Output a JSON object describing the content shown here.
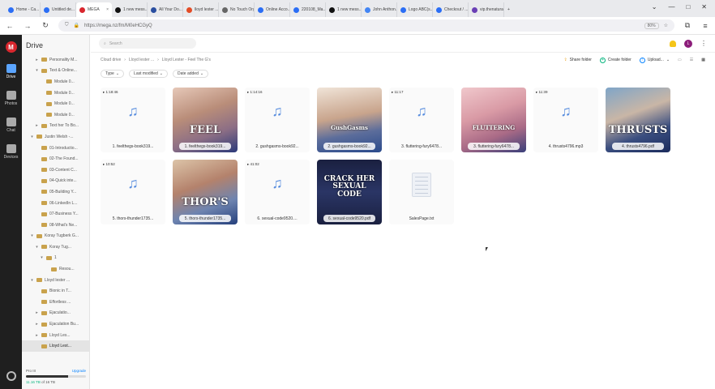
{
  "browser": {
    "tabs": [
      {
        "title": "Home - Ca...",
        "color": "#2b6ef5"
      },
      {
        "title": "Untitled de...",
        "color": "#2b6ef5"
      },
      {
        "title": "MEGA",
        "color": "#d9272e",
        "active": true
      },
      {
        "title": "1 new mess...",
        "color": "#111111"
      },
      {
        "title": "All Your Do...",
        "color": "#2b4fa0"
      },
      {
        "title": "lloyd lester ...",
        "color": "#e34c26"
      },
      {
        "title": "No Touch Orga...",
        "color": "#666666"
      },
      {
        "title": "Online Acco...",
        "color": "#2b6ef5"
      },
      {
        "title": "220108_Ma...",
        "color": "#2b6ef5"
      },
      {
        "title": "1 new mess...",
        "color": "#111111"
      },
      {
        "title": "John Anthon...",
        "color": "#4285f4"
      },
      {
        "title": "Logo ABC(s...",
        "color": "#2b6ef5"
      },
      {
        "title": "Checkout / ...",
        "color": "#2b6ef5"
      },
      {
        "title": "vip.thenatural...",
        "color": "#6a3fb5"
      }
    ],
    "url": "https://mega.nz/fm/M0eHCGyQ",
    "zoom": "80%",
    "window_controls": [
      "⌄",
      "—",
      "□",
      "✕"
    ]
  },
  "rail": {
    "items": [
      {
        "label": "Drive",
        "active": true
      },
      {
        "label": "Photos"
      },
      {
        "label": "Chat"
      },
      {
        "label": "Devices"
      }
    ]
  },
  "sidebar": {
    "title": "Drive",
    "tree": [
      {
        "label": "Personality M...",
        "indent": 2,
        "arrow": "▸"
      },
      {
        "label": "Text & Online...",
        "indent": 2,
        "arrow": "▾"
      },
      {
        "label": "Module 0...",
        "indent": 3,
        "arrow": ""
      },
      {
        "label": "Module 0...",
        "indent": 3,
        "arrow": ""
      },
      {
        "label": "Module 0...",
        "indent": 3,
        "arrow": ""
      },
      {
        "label": "Module 0...",
        "indent": 3,
        "arrow": ""
      },
      {
        "label": "Text her To Bo...",
        "indent": 2,
        "arrow": "▸"
      },
      {
        "label": "Justin Welsh -...",
        "indent": 1,
        "arrow": "▾"
      },
      {
        "label": "01-Introductio...",
        "indent": 2,
        "arrow": ""
      },
      {
        "label": "02-The Found...",
        "indent": 2,
        "arrow": ""
      },
      {
        "label": "03-Content C...",
        "indent": 2,
        "arrow": ""
      },
      {
        "label": "04-Quick inte...",
        "indent": 2,
        "arrow": ""
      },
      {
        "label": "05-Building Y...",
        "indent": 2,
        "arrow": ""
      },
      {
        "label": "06-LinkedIn L...",
        "indent": 2,
        "arrow": ""
      },
      {
        "label": "07-Business Y...",
        "indent": 2,
        "arrow": ""
      },
      {
        "label": "08-What's Ne...",
        "indent": 2,
        "arrow": ""
      },
      {
        "label": "Koray Tugberk G...",
        "indent": 1,
        "arrow": "▾"
      },
      {
        "label": "Koray Tug...",
        "indent": 2,
        "arrow": "▾"
      },
      {
        "label": "1",
        "indent": 3,
        "arrow": "▾"
      },
      {
        "label": "Resou...",
        "indent": 4,
        "arrow": ""
      },
      {
        "label": "Lloyd lester ...",
        "indent": 1,
        "arrow": "▾"
      },
      {
        "label": "Bionic in T...",
        "indent": 2,
        "arrow": ""
      },
      {
        "label": "Effortless ...",
        "indent": 2,
        "arrow": ""
      },
      {
        "label": "Ejaculatio...",
        "indent": 2,
        "arrow": "▸"
      },
      {
        "label": "Ejaculation Bu...",
        "indent": 2,
        "arrow": "▸"
      },
      {
        "label": "Lloyd Les...",
        "indent": 2,
        "arrow": "▸"
      },
      {
        "label": "Lloyd Lest...",
        "indent": 2,
        "arrow": "",
        "selected": true
      }
    ],
    "quota": {
      "plan": "Pro III",
      "upgrade": "Upgrade",
      "usage_prefix": "",
      "usage_used": "11.16 TB",
      "usage_rest": "of 16 TB",
      "fill": 0.7
    }
  },
  "main": {
    "search_placeholder": "Search",
    "avatar": "L",
    "breadcrumb": [
      "Cloud drive",
      "Lloyd lester ...",
      "Lloyd Lester - Feel The G's"
    ],
    "actions": {
      "share": "Share folder",
      "create": "Create folder",
      "upload": "Upload..."
    },
    "filters": [
      "Type",
      "Last modified",
      "Date added"
    ],
    "files": [
      {
        "type": "audio",
        "duration": "1:18:46",
        "name": "1. feelthegs-book319..."
      },
      {
        "type": "image",
        "thumb": "t1",
        "overlay": "FEEL",
        "name": "1. feelthegs-book319..."
      },
      {
        "type": "audio",
        "duration": "1:14:16",
        "name": "2. gushgasms-book92..."
      },
      {
        "type": "image",
        "thumb": "t2",
        "overlay": "GushGasms",
        "name": "2. gushgasms-book92..."
      },
      {
        "type": "audio",
        "duration": "11:17",
        "name": "3. fluttering-fury6478..."
      },
      {
        "type": "image",
        "thumb": "t3",
        "overlay": "FLUTTERING",
        "name": "3. fluttering-fury6478..."
      },
      {
        "type": "audio",
        "duration": "11:39",
        "name": "4. thrusts4796.mp3"
      },
      {
        "type": "image",
        "thumb": "t4",
        "overlay": "THRUSTS",
        "name": "4. thrusts4796.pdf"
      },
      {
        "type": "audio",
        "duration": "10:52",
        "name": "5. thors-thunder1735..."
      },
      {
        "type": "image",
        "thumb": "t5",
        "overlay": "THOR'S",
        "name": "5. thors-thunder1735..."
      },
      {
        "type": "audio",
        "duration": "41:02",
        "name": "6. sexual-code9520...."
      },
      {
        "type": "image",
        "thumb": "t6",
        "overlay": "CRACK HER SEXUAL CODE",
        "name": "6. sexual-code9520.pdf"
      },
      {
        "type": "doc",
        "name": "SalesPage.txt"
      }
    ]
  }
}
